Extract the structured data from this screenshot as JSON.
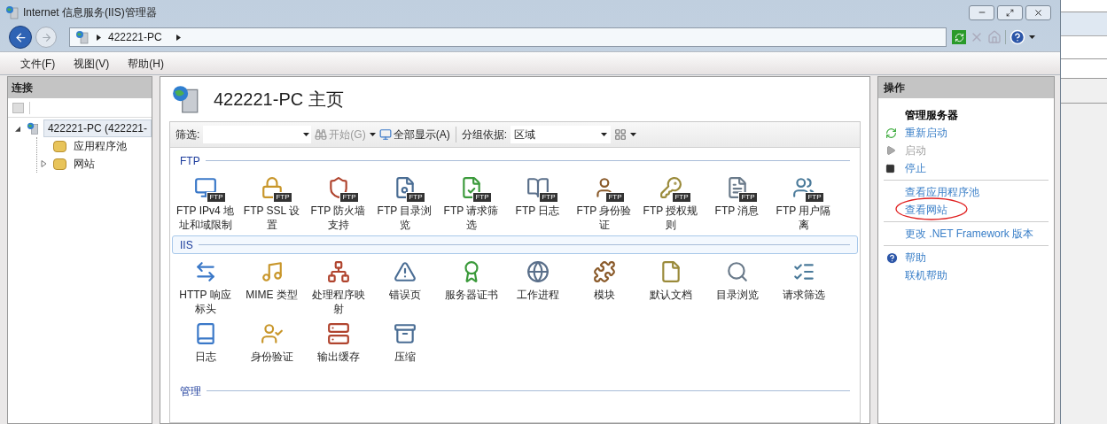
{
  "window": {
    "title": "Internet 信息服务(IIS)管理器"
  },
  "address_bar": {
    "path": [
      "422221-PC"
    ]
  },
  "menu": [
    "文件(F)",
    "视图(V)",
    "帮助(H)"
  ],
  "connections": {
    "title": "连接",
    "tree": [
      {
        "label": "422221-PC (422221-",
        "expanded": true,
        "selected": true,
        "children": [
          {
            "label": "应用程序池",
            "has_children": false
          },
          {
            "label": "网站",
            "has_children": true
          }
        ]
      }
    ]
  },
  "home": {
    "title": "422221-PC 主页",
    "toolbar": {
      "filter_label": "筛选:",
      "start_button": "开始(G)",
      "start_disabled": true,
      "show_all": "全部显示(A)",
      "group_by_label": "分组依据:",
      "group_by_value": "区域"
    },
    "groups": [
      {
        "title": "FTP",
        "selected": false,
        "features": [
          {
            "label": "FTP IPv4 地址和域限制",
            "badge": "FTP"
          },
          {
            "label": "FTP SSL 设置",
            "badge": "FTP"
          },
          {
            "label": "FTP 防火墙支持",
            "badge": "FTP"
          },
          {
            "label": "FTP 目录浏览",
            "badge": "FTP"
          },
          {
            "label": "FTP 请求筛选",
            "badge": "FTP"
          },
          {
            "label": "FTP 日志",
            "badge": "FTP"
          },
          {
            "label": "FTP 身份验证",
            "badge": "FTP"
          },
          {
            "label": "FTP 授权规则",
            "badge": "FTP"
          },
          {
            "label": "FTP 消息",
            "badge": "FTP"
          },
          {
            "label": "FTP 用户隔离",
            "badge": "FTP"
          }
        ]
      },
      {
        "title": "IIS",
        "selected": true,
        "features": [
          {
            "label": "HTTP 响应标头"
          },
          {
            "label": "MIME 类型"
          },
          {
            "label": "处理程序映射"
          },
          {
            "label": "错误页"
          },
          {
            "label": "服务器证书"
          },
          {
            "label": "工作进程"
          },
          {
            "label": "模块"
          },
          {
            "label": "默认文档"
          },
          {
            "label": "目录浏览"
          },
          {
            "label": "请求筛选"
          },
          {
            "label": "日志"
          },
          {
            "label": "身份验证"
          },
          {
            "label": "输出缓存"
          },
          {
            "label": "压缩"
          }
        ]
      },
      {
        "title": "管理",
        "selected": false
      }
    ]
  },
  "actions": {
    "title": "操作",
    "groups": [
      [
        {
          "kind": "heading",
          "label": "管理服务器",
          "disabled": false,
          "circled": false
        },
        {
          "kind": "restart",
          "label": "重新启动",
          "disabled": false,
          "circled": false
        },
        {
          "kind": "start",
          "label": "启动",
          "disabled": true,
          "circled": false
        },
        {
          "kind": "stop",
          "label": "停止",
          "disabled": false,
          "circled": false
        }
      ],
      [
        {
          "kind": "link",
          "label": "查看应用程序池",
          "disabled": false,
          "circled": false
        },
        {
          "kind": "link",
          "label": "查看网站",
          "disabled": false,
          "circled": true
        }
      ],
      [
        {
          "kind": "link",
          "label": "更改 .NET Framework 版本",
          "disabled": false,
          "circled": false
        }
      ],
      [
        {
          "kind": "help",
          "label": "帮助",
          "disabled": false,
          "circled": false
        },
        {
          "kind": "link",
          "label": "联机帮助",
          "disabled": false,
          "circled": false
        }
      ]
    ]
  }
}
